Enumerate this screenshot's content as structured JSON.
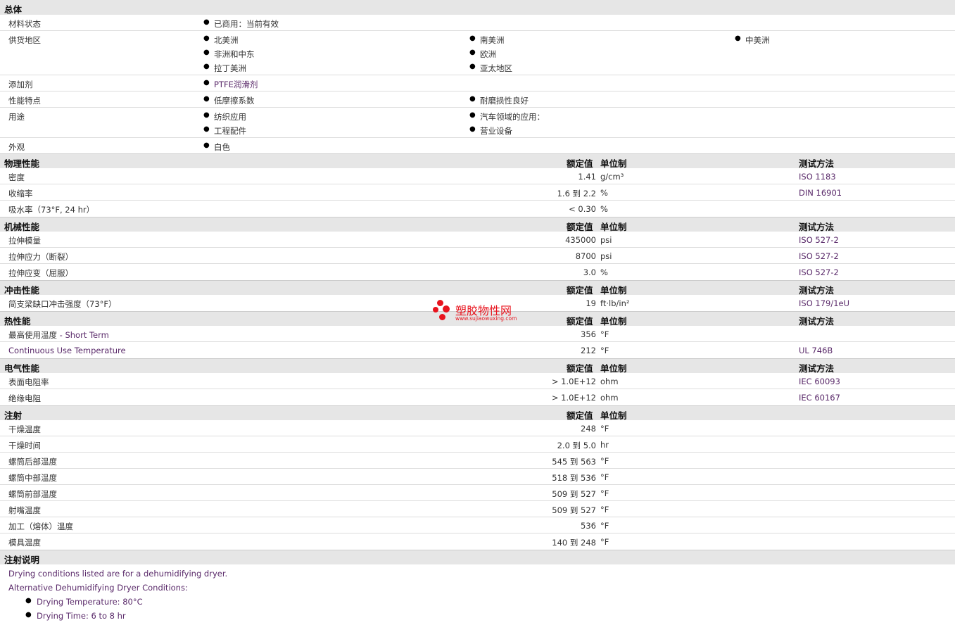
{
  "general": {
    "title": "总体",
    "material_status_label": "材料状态",
    "material_status": "已商用：当前有效",
    "availability_label": "供货地区",
    "availability": [
      "北美洲",
      "南美洲",
      "中美洲",
      "非洲和中东",
      "欧洲",
      "拉丁美洲",
      "亚太地区"
    ],
    "additives_label": "添加剂",
    "additives": "PTFE润滑剂",
    "features_label": "性能特点",
    "features": [
      "低摩擦系数",
      "耐磨损性良好"
    ],
    "uses_label": "用途",
    "uses": [
      "纺织应用",
      "汽车领域的应用：",
      "工程配件",
      "营业设备"
    ],
    "appearance_label": "外观",
    "appearance": "白色"
  },
  "headers": {
    "nominal": "额定值",
    "unit": "单位制",
    "method": "测试方法"
  },
  "physical": {
    "title": "物理性能",
    "rows": [
      {
        "label": "密度",
        "value": "1.41",
        "unit": "g/cm³",
        "method": "ISO 1183"
      },
      {
        "label": "收缩率",
        "value": "1.6 到  2.2",
        "unit": "%",
        "method": "DIN 16901"
      },
      {
        "label": "吸水率（73°F, 24 hr）",
        "value": "< 0.30",
        "unit": "%",
        "method": ""
      }
    ]
  },
  "mechanical": {
    "title": "机械性能",
    "rows": [
      {
        "label": "拉伸模量",
        "value": "435000",
        "unit": "psi",
        "method": "ISO 527-2"
      },
      {
        "label": "拉伸应力（断裂）",
        "value": "8700",
        "unit": "psi",
        "method": "ISO 527-2"
      },
      {
        "label": "拉伸应变（屈服）",
        "value": "3.0",
        "unit": "%",
        "method": "ISO 527-2"
      }
    ]
  },
  "impact": {
    "title": "冲击性能",
    "rows": [
      {
        "label": "简支梁缺口冲击强度（73°F）",
        "value": "19",
        "unit": "ft·lb/in²",
        "method": "ISO 179/1eU"
      }
    ]
  },
  "thermal": {
    "title": "热性能",
    "rows": [
      {
        "label": "最高使用温度",
        "label_suffix": " - Short Term",
        "value": "356",
        "unit": "°F",
        "method": ""
      },
      {
        "label": "Continuous Use Temperature",
        "value": "212",
        "unit": "°F",
        "method": "UL 746B"
      }
    ]
  },
  "electrical": {
    "title": "电气性能",
    "rows": [
      {
        "label": "表面电阻率",
        "value": "> 1.0E+12",
        "unit": "ohm",
        "method": "IEC 60093"
      },
      {
        "label": "绝缘电阻",
        "value": "> 1.0E+12",
        "unit": "ohm",
        "method": "IEC 60167"
      }
    ]
  },
  "injection": {
    "title": "注射",
    "rows": [
      {
        "label": "干燥温度",
        "value": "248",
        "unit": "°F"
      },
      {
        "label": "干燥时间",
        "value": "2.0 到  5.0",
        "unit": "hr"
      },
      {
        "label": "螺筒后部温度",
        "value": "545 到  563",
        "unit": "°F"
      },
      {
        "label": "螺筒中部温度",
        "value": "518 到  536",
        "unit": "°F"
      },
      {
        "label": "螺筒前部温度",
        "value": "509 到  527",
        "unit": "°F"
      },
      {
        "label": "射嘴温度",
        "value": "509 到  527",
        "unit": "°F"
      },
      {
        "label": "加工（熔体）温度",
        "value": "536",
        "unit": "°F"
      },
      {
        "label": "模具温度",
        "value": "140 到  248",
        "unit": "°F"
      }
    ]
  },
  "notes": {
    "title": "注射说明",
    "line1": "Drying conditions listed are for a dehumidifying dryer.",
    "line2": "Alternative Dehumidifying Dryer Conditions:",
    "bullets": [
      "Drying Temperature: 80°C",
      "Drying Time: 6 to 8 hr"
    ]
  },
  "watermark": {
    "name": "塑胶物性网",
    "url": "www.sujiaowuxing.com"
  }
}
